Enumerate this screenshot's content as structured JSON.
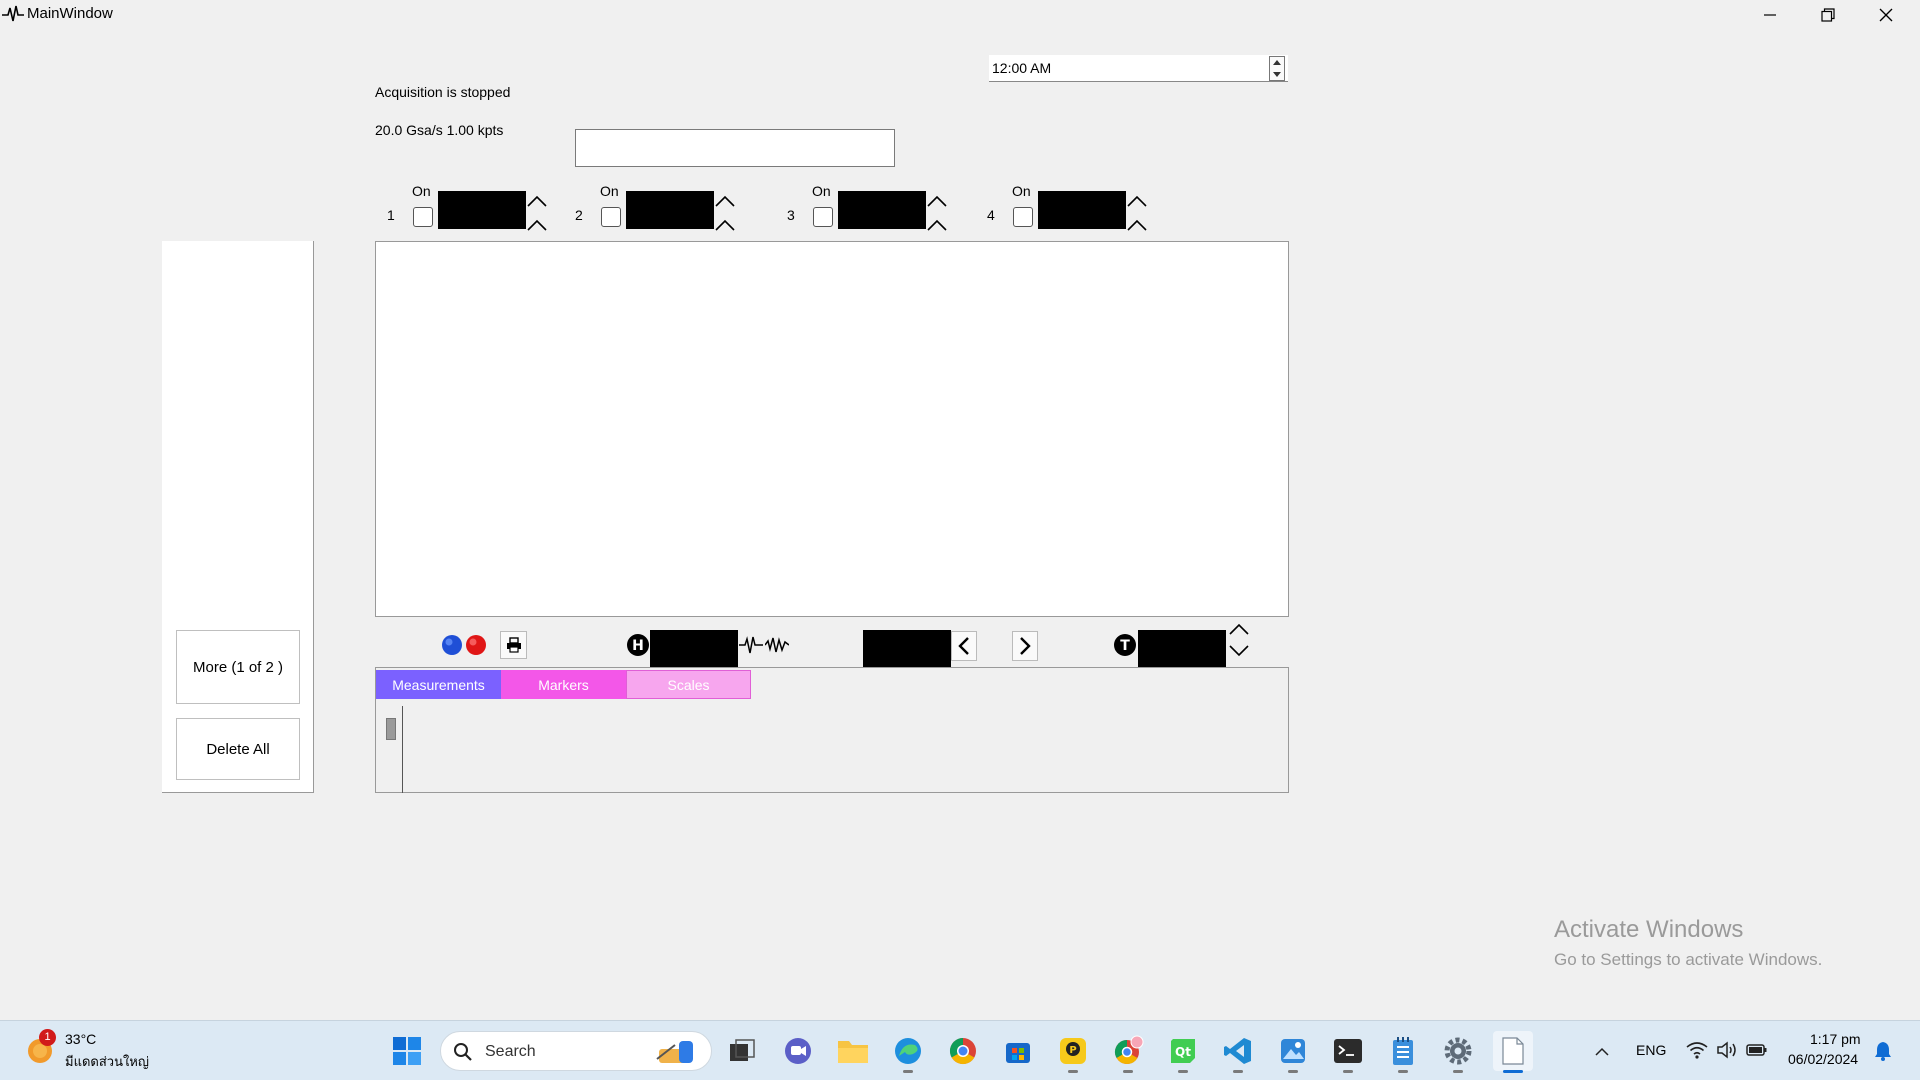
{
  "window": {
    "title": "MainWindow"
  },
  "status": {
    "acquisition": "Acquisition is stopped",
    "sample_info": "20.0 Gsa/s  1.00 kpts"
  },
  "time_edit": {
    "value": "12:00 AM"
  },
  "channels": [
    {
      "number": "1",
      "on_label": "On"
    },
    {
      "number": "2",
      "on_label": "On"
    },
    {
      "number": "3",
      "on_label": "On"
    },
    {
      "number": "4",
      "on_label": "On"
    }
  ],
  "side_panel": {
    "more_button": "More (1 of 2 )",
    "delete_all_button": "Delete All"
  },
  "tabs": [
    {
      "label": "Measurements",
      "bg": "#7b61ff",
      "fg": "#ffffff"
    },
    {
      "label": "Markers",
      "bg": "#f357e8",
      "fg": "#ffffff"
    },
    {
      "label": "Scales",
      "bg": "#f7a6ee",
      "fg": "#ffffff"
    }
  ],
  "watermark": {
    "line1": "Activate Windows",
    "line2": "Go to Settings to activate Windows."
  },
  "taskbar": {
    "weather_temp": "33°C",
    "weather_desc": "มีแดดส่วนใหญ่",
    "weather_badge": "1",
    "search_label": "Search",
    "language": "ENG",
    "time": "1:17 pm",
    "date": "06/02/2024"
  },
  "icons": {
    "app": "waveform-icon",
    "run_stop": [
      "blue-circle-icon",
      "red-circle-icon"
    ],
    "print": "printer-icon",
    "horizontal": "h-circle-icon",
    "trigger": "t-circle-icon"
  }
}
